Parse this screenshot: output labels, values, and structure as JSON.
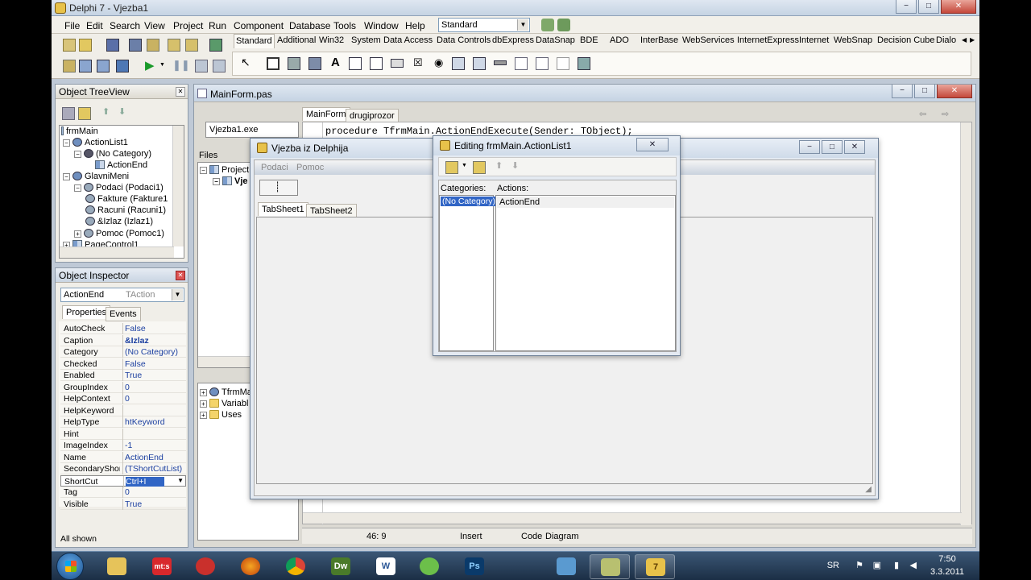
{
  "window": {
    "title": "Delphi 7 - Vjezba1",
    "min": "−",
    "max": "□",
    "close": "✕"
  },
  "menu": [
    "File",
    "Edit",
    "Search",
    "View",
    "Project",
    "Run",
    "Component",
    "Database",
    "Tools",
    "Window",
    "Help"
  ],
  "desktop_combo": {
    "value": "Standard"
  },
  "palette_tabs": [
    "Standard",
    "Additional",
    "Win32",
    "System",
    "Data Access",
    "Data Controls",
    "dbExpress",
    "DataSnap",
    "BDE",
    "ADO",
    "InterBase",
    "WebServices",
    "InternetExpress",
    "Internet",
    "WebSnap",
    "Decision Cube",
    "Dialo"
  ],
  "tree_view": {
    "title": "Object TreeView",
    "rows": [
      {
        "label": "frmMain",
        "icon": "form-icon"
      },
      {
        "label": "ActionList1",
        "icon": "actionlist-icon"
      },
      {
        "label": "(No Category)",
        "icon": "category-icon"
      },
      {
        "label": "ActionEnd",
        "icon": "action-icon"
      },
      {
        "label": "GlavniMeni",
        "icon": "menu-icon"
      },
      {
        "label": "Podaci (Podaci1)",
        "icon": "menuitem-icon"
      },
      {
        "label": "Fakture (Fakture1",
        "icon": "menuitem-icon"
      },
      {
        "label": "Racuni (Racuni1)",
        "icon": "menuitem-icon"
      },
      {
        "label": "&Izlaz (Izlaz1)",
        "icon": "menuitem-icon"
      },
      {
        "label": "Pomoc (Pomoc1)",
        "icon": "menuitem-icon"
      },
      {
        "label": "PageControl1",
        "icon": "pagecontrol-icon"
      }
    ]
  },
  "inspector": {
    "title": "Object Inspector",
    "selected_name": "ActionEnd",
    "selected_type": "TAction",
    "tabs": [
      "Properties",
      "Events"
    ],
    "rows": [
      {
        "k": "AutoCheck",
        "v": "False"
      },
      {
        "k": "Caption",
        "v": "&Izlaz"
      },
      {
        "k": "Category",
        "v": "(No Category)"
      },
      {
        "k": "Checked",
        "v": "False"
      },
      {
        "k": "Enabled",
        "v": "True"
      },
      {
        "k": "GroupIndex",
        "v": "0"
      },
      {
        "k": "HelpContext",
        "v": "0"
      },
      {
        "k": "HelpKeyword",
        "v": ""
      },
      {
        "k": "HelpType",
        "v": "htKeyword"
      },
      {
        "k": "Hint",
        "v": ""
      },
      {
        "k": "ImageIndex",
        "v": "-1"
      },
      {
        "k": "Name",
        "v": "ActionEnd"
      },
      {
        "k": "SecondaryShor",
        "v": "(TShortCutList)"
      },
      {
        "k": "ShortCut",
        "v": "Ctrl+I"
      },
      {
        "k": "Tag",
        "v": "0"
      },
      {
        "k": "Visible",
        "v": "True"
      }
    ],
    "status": "All shown"
  },
  "editor": {
    "title": "MainForm.pas",
    "tabs": [
      "MainForm",
      "drugiprozor"
    ],
    "code_line": "procedure TfrmMain.ActionEndExecute(Sender: TObject);",
    "project_file": "Vjezba1.exe",
    "files_label": "Files",
    "project_label": "Project",
    "project_child": "Vje",
    "explorer_rows": [
      "TfrmMa",
      "Variabl",
      "Uses"
    ],
    "status_pos": "46:  9",
    "status_mode": "Insert",
    "bottom_tabs": [
      "Code",
      "Diagram"
    ]
  },
  "form_window": {
    "title": "Vjezba iz Delphija",
    "menu": [
      "Podaci",
      "Pomoc"
    ],
    "tabs": [
      "TabSheet1",
      "TabSheet2"
    ]
  },
  "action_editor": {
    "title": "Editing frmMain.ActionList1",
    "categories_label": "Categories:",
    "actions_label": "Actions:",
    "categories": [
      "(No Category)"
    ],
    "actions": [
      "ActionEnd"
    ]
  },
  "taskbar": {
    "apps": [
      {
        "name": "explorer",
        "label": ""
      },
      {
        "name": "mts",
        "label": "mt:s"
      },
      {
        "name": "antivirus",
        "label": ""
      },
      {
        "name": "firefox",
        "label": ""
      },
      {
        "name": "chrome",
        "label": ""
      },
      {
        "name": "dreamweaver",
        "label": "Dw"
      },
      {
        "name": "word",
        "label": "W"
      },
      {
        "name": "recycle",
        "label": ""
      },
      {
        "name": "photoshop",
        "label": "Ps"
      },
      {
        "name": "network",
        "label": ""
      },
      {
        "name": "notes",
        "label": ""
      },
      {
        "name": "delphi",
        "label": "7"
      }
    ],
    "lang": "SR",
    "time": "7:50",
    "date": "3.3.2011"
  },
  "colors": {
    "selection": "#3165c5",
    "value_blue": "#1b3fa0",
    "titlebar": "#cfdbe9"
  }
}
